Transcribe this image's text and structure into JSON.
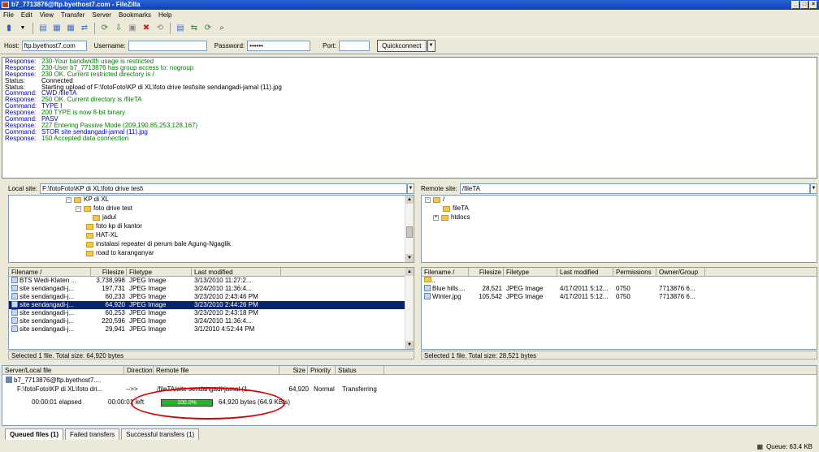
{
  "window": {
    "title": "b7_7713876@ftp.byethost7.com - FileZilla",
    "min": "_",
    "max": "□",
    "close": "×"
  },
  "menu": [
    "File",
    "Edit",
    "View",
    "Transfer",
    "Server",
    "Bookmarks",
    "Help"
  ],
  "toolbar_icons": [
    "site-manager-icon",
    "dropdown-icon",
    "log-toggle-icon",
    "tree-local-icon",
    "tree-remote-icon",
    "queue-toggle-icon",
    "refresh-icon",
    "process-queue-icon",
    "cancel-icon",
    "disconnect-icon",
    "reconnect-icon",
    "filter-icon",
    "compare-icon",
    "sync-browse-icon",
    "find-icon"
  ],
  "quickconnect": {
    "host_label": "Host:",
    "host": "ftp.byethost7.com",
    "user_label": "Username:",
    "user": "",
    "pass_label": "Password:",
    "pass": "••••••",
    "port_label": "Port:",
    "port": "",
    "button": "Quickconnect",
    "drop": "▼"
  },
  "log": [
    {
      "t": "Response:",
      "m": "230-Your bandwidth usage is restricted"
    },
    {
      "t": "Response:",
      "m": "230-User b7_7713876 has group access to:  nogroup"
    },
    {
      "t": "Response:",
      "m": "230 OK. Current restricted directory is /"
    },
    {
      "t": "Status:",
      "m": "Connected"
    },
    {
      "t": "Status:",
      "m": "Starting upload of F:\\fotoFoto\\KP di XL\\foto drive test\\site sendangadi-jamal (11).jpg"
    },
    {
      "t": "Command:",
      "m": "CWD /fileTA"
    },
    {
      "t": "Response:",
      "m": "250 OK. Current directory is /fileTA"
    },
    {
      "t": "Command:",
      "m": "TYPE I"
    },
    {
      "t": "Response:",
      "m": "200 TYPE is now 8-bit binary"
    },
    {
      "t": "Command:",
      "m": "PASV"
    },
    {
      "t": "Response:",
      "m": "227 Entering Passive Mode (209,190,85,253,128,167)"
    },
    {
      "t": "Command:",
      "m": "STOR site sendangadi-jamal (11).jpg"
    },
    {
      "t": "Response:",
      "m": "150 Accepted data connection"
    }
  ],
  "local": {
    "label": "Local site:",
    "path": "F:\\fotoFoto\\KP di XL\\foto drive test\\",
    "tree": [
      {
        "name": "KP di XL",
        "exp": "−"
      },
      {
        "name": "foto drive test",
        "exp": "−"
      },
      {
        "name": "jadul",
        "exp": ""
      },
      {
        "name": "foto kp di kantor",
        "exp": ""
      },
      {
        "name": "HAT-XL",
        "exp": ""
      },
      {
        "name": "instalasi repeater di perum bale Agung-Ngaglik",
        "exp": ""
      },
      {
        "name": "road to karanganyar",
        "exp": ""
      }
    ],
    "headers": [
      "Filename  /",
      "Filesize",
      "Filetype",
      "Last modified"
    ],
    "files": [
      [
        "BTS Wedi-Klaten ...",
        "3,738,998",
        "JPEG Image",
        "3/13/2010 11:27:2..."
      ],
      [
        "site sendangadi-j...",
        "197,731",
        "JPEG Image",
        "3/24/2010 11:36:4..."
      ],
      [
        "site sendangadi-j...",
        "60,233",
        "JPEG Image",
        "3/23/2010 2:43:46 PM"
      ],
      [
        "site sendangadi-j...",
        "64,920",
        "JPEG Image",
        "3/23/2010 2:44:26 PM"
      ],
      [
        "site sendangadi-j...",
        "60,253",
        "JPEG Image",
        "3/23/2010 2:43:18 PM"
      ],
      [
        "site sendangadi-j...",
        "220,596",
        "JPEG Image",
        "3/24/2010 11:36:4..."
      ],
      [
        "site sendangadi-j...",
        "29,941",
        "JPEG Image",
        "3/1/2010 4:52:44 PM"
      ]
    ],
    "selected_index": 3,
    "status": "Selected 1 file. Total size: 64,920 bytes"
  },
  "remote": {
    "label": "Remote site:",
    "path": "/fileTA",
    "tree": [
      {
        "name": "/",
        "exp": "−"
      },
      {
        "name": "fileTA",
        "exp": ""
      },
      {
        "name": "htdocs",
        "exp": "+"
      }
    ],
    "headers": [
      "Filename  /",
      "Filesize",
      "Filetype",
      "Last modified",
      "Permissions",
      "Owner/Group"
    ],
    "files": [
      [
        "..",
        "",
        "",
        "",
        "",
        ""
      ],
      [
        "Blue hills....",
        "28,521",
        "JPEG Image",
        "4/17/2011 5:12...",
        "0750",
        "7713876 6..."
      ],
      [
        "Winter.jpg",
        "105,542",
        "JPEG Image",
        "4/17/2011 5:12...",
        "0750",
        "7713876 6..."
      ]
    ],
    "status": "Selected 1 file. Total size: 28,521 bytes"
  },
  "queue": {
    "headers": [
      "Server/Local file",
      "Direction",
      "Remote file",
      "Size",
      "Priority",
      "Status"
    ],
    "server": "b7_7713876@ftp.byethost7....",
    "local_file": "F:\\fotoFoto\\KP di XL\\foto dri...",
    "direction": "-->>",
    "remote_file": "/fileTA/site sendangadi-jamal (1...",
    "size": "64,920",
    "priority": "Normal",
    "status": "Transferring",
    "elapsed": "00:00:01 elapsed",
    "left": "00:00:01 left",
    "progress_pct": 100.0,
    "progress_text": "100.0%",
    "bytes": "64,920 bytes (64.9 KB/s)"
  },
  "tabs": [
    "Queued files (1)",
    "Failed transfers",
    "Successful transfers (1)"
  ],
  "statusbar": {
    "queue": "Queue: 63.4 KB"
  }
}
